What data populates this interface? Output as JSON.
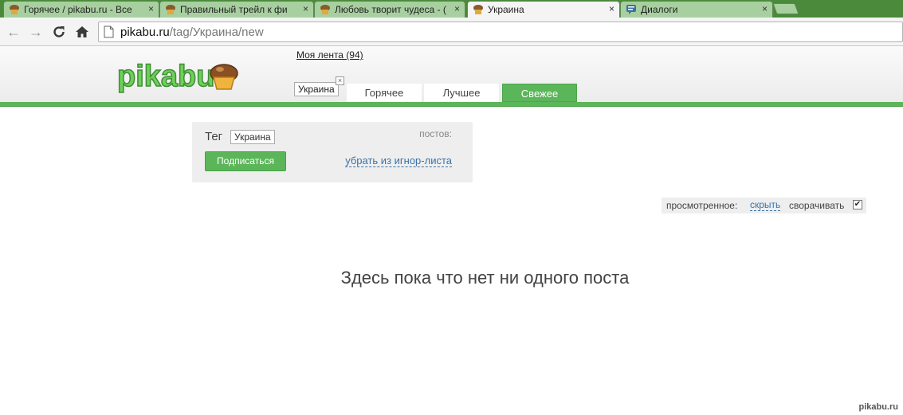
{
  "browser": {
    "tabs": [
      {
        "title": "Горячее / pikabu.ru - Все",
        "active": false
      },
      {
        "title": "Правильный трейл к фи",
        "active": false
      },
      {
        "title": "Любовь творит чудеса - (",
        "active": false
      },
      {
        "title": "Украина",
        "active": true
      },
      {
        "title": "Диалоги",
        "active": false
      }
    ],
    "close_glyph": "×",
    "url_host": "pikabu.ru",
    "url_path": "/tag/Украина/new"
  },
  "header": {
    "feed_link": "Моя лента (94)",
    "tag_chip": "Украина",
    "tag_chip_close": "×",
    "tabs": [
      {
        "label": "Горячее",
        "active": false
      },
      {
        "label": "Лучшее",
        "active": false
      },
      {
        "label": "Свежее",
        "active": true
      }
    ],
    "accent_color": "#5bb659"
  },
  "tag_panel": {
    "label": "Тег",
    "tag_name": "Украина",
    "posts_label": "постов:",
    "subscribe_label": "Подписаться",
    "ignore_link": "убрать из игнор-листа"
  },
  "viewed": {
    "label": "просмотренное:",
    "hide_link": "скрыть",
    "collapse_label": "сворачивать",
    "collapse_checked": true,
    "check_glyph": "✔"
  },
  "main": {
    "empty_message": "Здесь пока что нет ни одного поста"
  },
  "watermark": "pikabu.ru"
}
